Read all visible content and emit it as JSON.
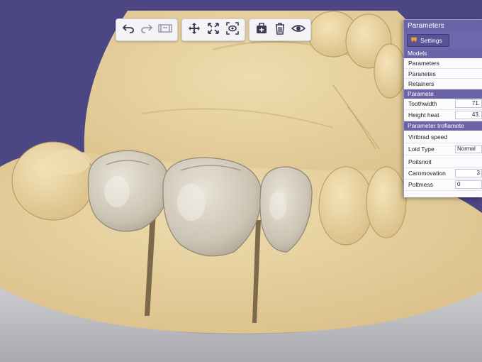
{
  "panel": {
    "title": "Parameters",
    "settings_label": "Settings",
    "models_header": "Models",
    "model_items": [
      "Parameters",
      "Paranetes",
      "Retainers"
    ],
    "parameter_header": "Paramete",
    "toothwidth_label": "Toothwidth",
    "toothwidth_value": "71.",
    "height_label": "Height heat",
    "height_value": "43.",
    "trofiamete_header": "Parameter trofiamete",
    "virtbrad_label": "Virtbrad speed",
    "loid_label": "Loid Type",
    "loid_value": "Normal",
    "poitsnoit_label": "Poitsnoit",
    "caromovation_label": "Caromovation",
    "caromovation_value": "3",
    "poltmess_label": "Poltmess",
    "poltmess_value": "0"
  },
  "toolbar": {
    "groups": [
      [
        "undo-icon",
        "redo-icon",
        "film-strip-icon"
      ],
      [
        "move-icon",
        "expand-icon",
        "focus-view-icon"
      ],
      [
        "add-item-icon",
        "trash-icon",
        "eye-icon"
      ]
    ]
  },
  "colors": {
    "background": "#4d4684",
    "model": "#e8d3a4",
    "tooth": "#cfc7b8",
    "panel_header": "#6b63a8"
  }
}
